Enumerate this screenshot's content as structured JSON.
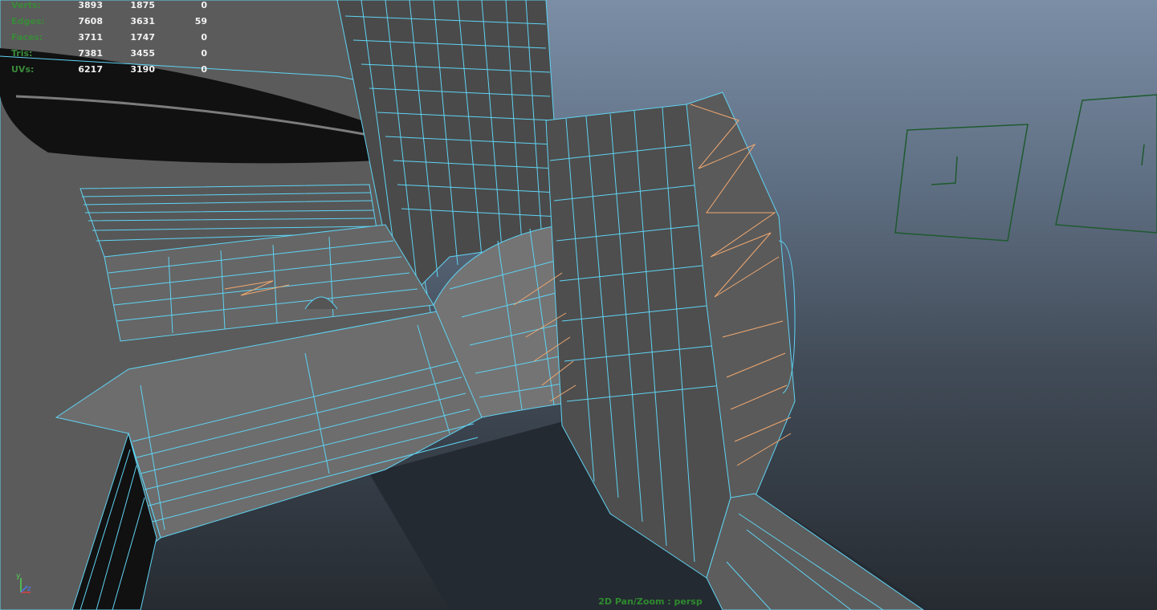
{
  "heads_up_display": {
    "rows": [
      {
        "label": "Verts:",
        "values": [
          "3893",
          "1875",
          "0"
        ]
      },
      {
        "label": "Edges:",
        "values": [
          "7608",
          "3631",
          "59"
        ]
      },
      {
        "label": "Faces:",
        "values": [
          "3711",
          "1747",
          "0"
        ]
      },
      {
        "label": "Tris:",
        "values": [
          "7381",
          "3455",
          "0"
        ]
      },
      {
        "label": "UVs:",
        "values": [
          "6217",
          "3190",
          "0"
        ]
      }
    ]
  },
  "camera_label": "2D Pan/Zoom : persp",
  "axis_gizmo": {
    "y_label": "y",
    "z_label": "z"
  },
  "colors": {
    "wire": "#5fd3f3",
    "selected_edge": "#f0a870",
    "hud_label": "#3a8a3a",
    "hud_value": "#f2f2f2",
    "camera_label": "#2e8a2e",
    "locator": "#1e5a2e"
  }
}
